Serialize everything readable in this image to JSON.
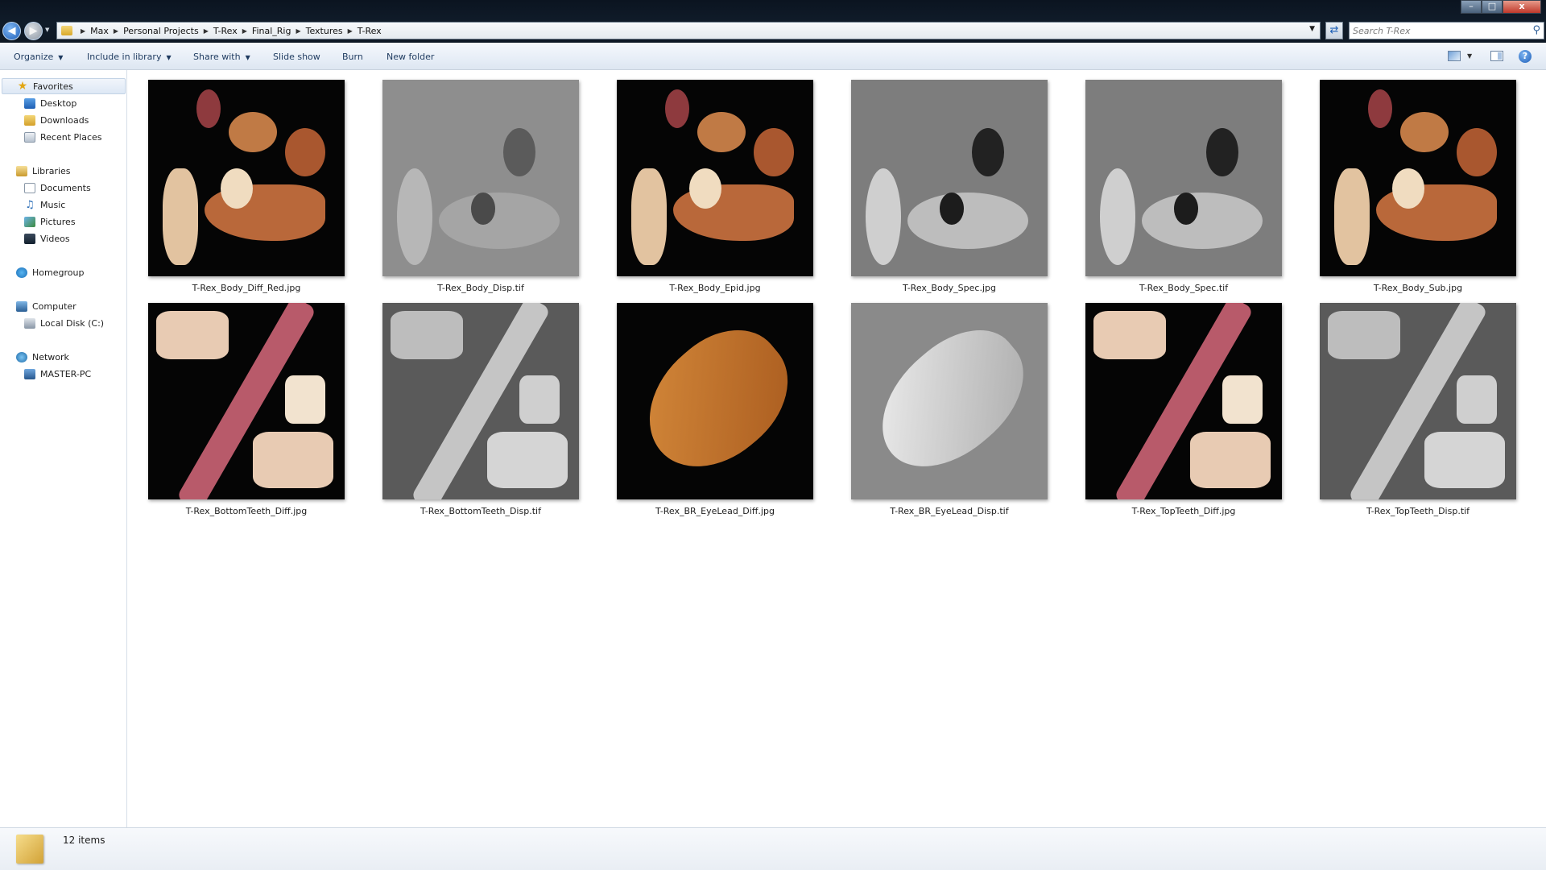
{
  "window": {
    "minimize_glyph": "–",
    "maximize_glyph": "□",
    "close_glyph": "x"
  },
  "address": {
    "breadcrumbs": [
      "Max",
      "Personal Projects",
      "T-Rex",
      "Final_Rig",
      "Textures",
      "T-Rex"
    ]
  },
  "search": {
    "placeholder": "Search T-Rex"
  },
  "toolbar": {
    "organize_label": "Organize",
    "include_label": "Include in library",
    "share_label": "Share with",
    "slideshow_label": "Slide show",
    "burn_label": "Burn",
    "newfolder_label": "New folder",
    "help_glyph": "?"
  },
  "nav": {
    "favorites": "Favorites",
    "desktop": "Desktop",
    "downloads": "Downloads",
    "recent": "Recent Places",
    "libraries": "Libraries",
    "documents": "Documents",
    "music": "Music",
    "pictures": "Pictures",
    "videos": "Videos",
    "homegroup": "Homegroup",
    "computer": "Computer",
    "localdisk": "Local Disk (C:)",
    "network": "Network",
    "masterpc": "MASTER-PC"
  },
  "files": [
    {
      "name": "T-Rex_Body_Diff_Red.jpg",
      "kind": "diff"
    },
    {
      "name": "T-Rex_Body_Disp.tif",
      "kind": "disp"
    },
    {
      "name": "T-Rex_Body_Epid.jpg",
      "kind": "diff"
    },
    {
      "name": "T-Rex_Body_Spec.jpg",
      "kind": "spec"
    },
    {
      "name": "T-Rex_Body_Spec.tif",
      "kind": "spec"
    },
    {
      "name": "T-Rex_Body_Sub.jpg",
      "kind": "diff"
    },
    {
      "name": "T-Rex_BottomTeeth_Diff.jpg",
      "kind": "teeth_diff"
    },
    {
      "name": "T-Rex_BottomTeeth_Disp.tif",
      "kind": "teeth_disp"
    },
    {
      "name": "T-Rex_BR_EyeLead_Diff.jpg",
      "kind": "lid_diff"
    },
    {
      "name": "T-Rex_BR_EyeLead_Disp.tif",
      "kind": "lid_disp"
    },
    {
      "name": "T-Rex_TopTeeth_Diff.jpg",
      "kind": "teeth_diff"
    },
    {
      "name": "T-Rex_TopTeeth_Disp.tif",
      "kind": "teeth_disp"
    }
  ],
  "status": {
    "count": "12 items"
  },
  "colors": {
    "titlebar": "#0e1824",
    "toolbar": "#e7eef7",
    "selection": "#dde8f5"
  }
}
